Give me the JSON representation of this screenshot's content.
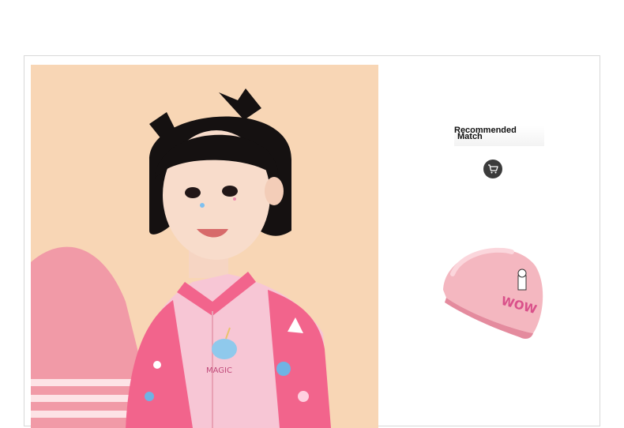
{
  "recommend": {
    "title_line1": "Recommended",
    "title_line2": "Match"
  },
  "photo": {
    "badge_text": "MAGIC"
  },
  "product": {
    "cap_text": "WOW",
    "cart_icon": "cart-icon"
  },
  "colors": {
    "border": "#d9d9d9",
    "photo_bg": "#f8d6b5",
    "cart_button": "#3b3b3b",
    "cap_pink": "#f4b7c0",
    "suit_pink": "#f2648c"
  }
}
